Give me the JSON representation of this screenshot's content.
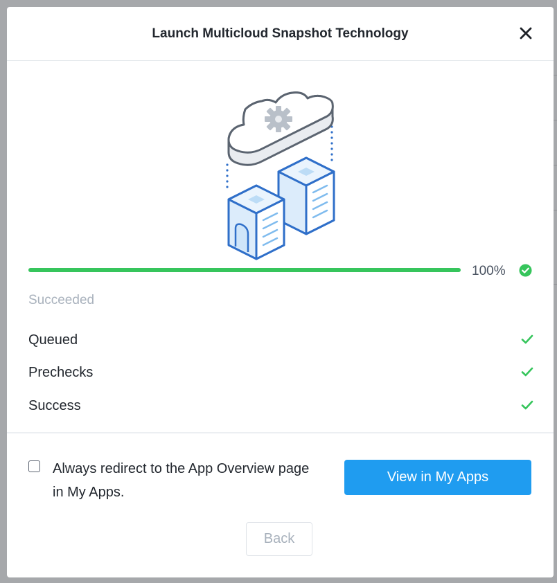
{
  "dialog": {
    "title": "Launch Multicloud Snapshot Technology",
    "close_icon": "close-icon"
  },
  "illustration": {
    "icon": "cloud-servers-illustration"
  },
  "progress": {
    "value": 100,
    "label": "100%",
    "status_icon": "check-circle-icon",
    "color": "#36c55c"
  },
  "status": "Succeeded",
  "steps": [
    {
      "label": "Queued",
      "icon": "check-icon"
    },
    {
      "label": "Prechecks",
      "icon": "check-icon"
    },
    {
      "label": "Success",
      "icon": "check-icon"
    }
  ],
  "footer": {
    "redirect_checked": false,
    "redirect_label": "Always redirect to the App Overview page in My Apps.",
    "primary_button": "View in My Apps",
    "back_button": "Back",
    "accent_color": "#1f9cf0"
  }
}
